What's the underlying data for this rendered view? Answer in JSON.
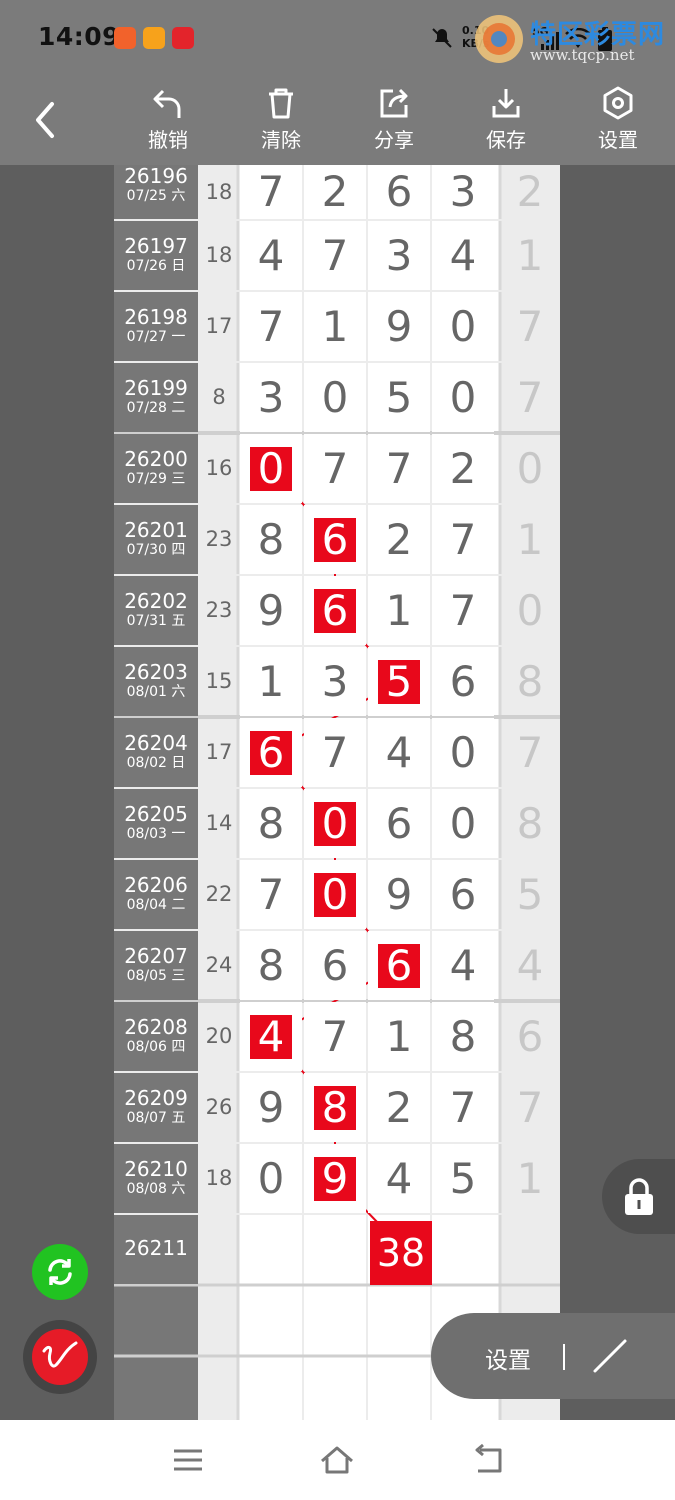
{
  "status_bar": {
    "time": "14:09",
    "speed_line1": "0.10",
    "speed_line2": "KB/s",
    "network": "5G",
    "icons": [
      "app-icon-1",
      "app-icon-2",
      "app-icon-3",
      "mute-icon",
      "signal-icon",
      "wifi-icon",
      "battery-icon"
    ]
  },
  "watermark": {
    "title": "特区彩票网",
    "url": "www.tqcp.net"
  },
  "toolbar": {
    "back": "back-icon",
    "items": [
      {
        "label": "撤销",
        "icon": "undo-icon"
      },
      {
        "label": "清除",
        "icon": "trash-icon"
      },
      {
        "label": "分享",
        "icon": "share-icon"
      },
      {
        "label": "保存",
        "icon": "download-icon"
      },
      {
        "label": "设置",
        "icon": "hexagon-settings-icon"
      }
    ]
  },
  "rows": [
    {
      "issue": "26196",
      "date": "07/25 六",
      "sum": "18",
      "d": [
        "7",
        "2",
        "6",
        "3"
      ],
      "last": "2",
      "hl": -1
    },
    {
      "issue": "26197",
      "date": "07/26 日",
      "sum": "18",
      "d": [
        "4",
        "7",
        "3",
        "4"
      ],
      "last": "1",
      "hl": -1
    },
    {
      "issue": "26198",
      "date": "07/27 一",
      "sum": "17",
      "d": [
        "7",
        "1",
        "9",
        "0"
      ],
      "last": "7",
      "hl": -1
    },
    {
      "issue": "26199",
      "date": "07/28 二",
      "sum": "8",
      "d": [
        "3",
        "0",
        "5",
        "0"
      ],
      "last": "7",
      "hl": -1
    },
    {
      "issue": "26200",
      "date": "07/29 三",
      "sum": "16",
      "d": [
        "0",
        "7",
        "7",
        "2"
      ],
      "last": "0",
      "hl": 0
    },
    {
      "issue": "26201",
      "date": "07/30 四",
      "sum": "23",
      "d": [
        "8",
        "6",
        "2",
        "7"
      ],
      "last": "1",
      "hl": 1
    },
    {
      "issue": "26202",
      "date": "07/31 五",
      "sum": "23",
      "d": [
        "9",
        "6",
        "1",
        "7"
      ],
      "last": "0",
      "hl": 1
    },
    {
      "issue": "26203",
      "date": "08/01 六",
      "sum": "15",
      "d": [
        "1",
        "3",
        "5",
        "6"
      ],
      "last": "8",
      "hl": 2
    },
    {
      "issue": "26204",
      "date": "08/02 日",
      "sum": "17",
      "d": [
        "6",
        "7",
        "4",
        "0"
      ],
      "last": "7",
      "hl": 0
    },
    {
      "issue": "26205",
      "date": "08/03 一",
      "sum": "14",
      "d": [
        "8",
        "0",
        "6",
        "0"
      ],
      "last": "8",
      "hl": 1
    },
    {
      "issue": "26206",
      "date": "08/04 二",
      "sum": "22",
      "d": [
        "7",
        "0",
        "9",
        "6"
      ],
      "last": "5",
      "hl": 1
    },
    {
      "issue": "26207",
      "date": "08/05 三",
      "sum": "24",
      "d": [
        "8",
        "6",
        "6",
        "4"
      ],
      "last": "4",
      "hl": 2
    },
    {
      "issue": "26208",
      "date": "08/06 四",
      "sum": "20",
      "d": [
        "4",
        "7",
        "1",
        "8"
      ],
      "last": "6",
      "hl": 0
    },
    {
      "issue": "26209",
      "date": "08/07 五",
      "sum": "26",
      "d": [
        "9",
        "8",
        "2",
        "7"
      ],
      "last": "7",
      "hl": 1
    },
    {
      "issue": "26210",
      "date": "08/08 六",
      "sum": "18",
      "d": [
        "0",
        "9",
        "4",
        "5"
      ],
      "last": "1",
      "hl": 1
    }
  ],
  "next_issue": {
    "issue": "26211",
    "sum_box": "38"
  },
  "floating": {
    "lock": "lock-icon",
    "settings_label": "设置",
    "pen": "pen-icon",
    "refresh": "refresh-icon",
    "sign": "signature-icon"
  },
  "nav": [
    "menu-icon",
    "home-icon",
    "back-nav-icon"
  ],
  "colors": {
    "highlight": "#e8081b",
    "toolbar": "#7b7b7b",
    "refresh": "#21c321"
  }
}
